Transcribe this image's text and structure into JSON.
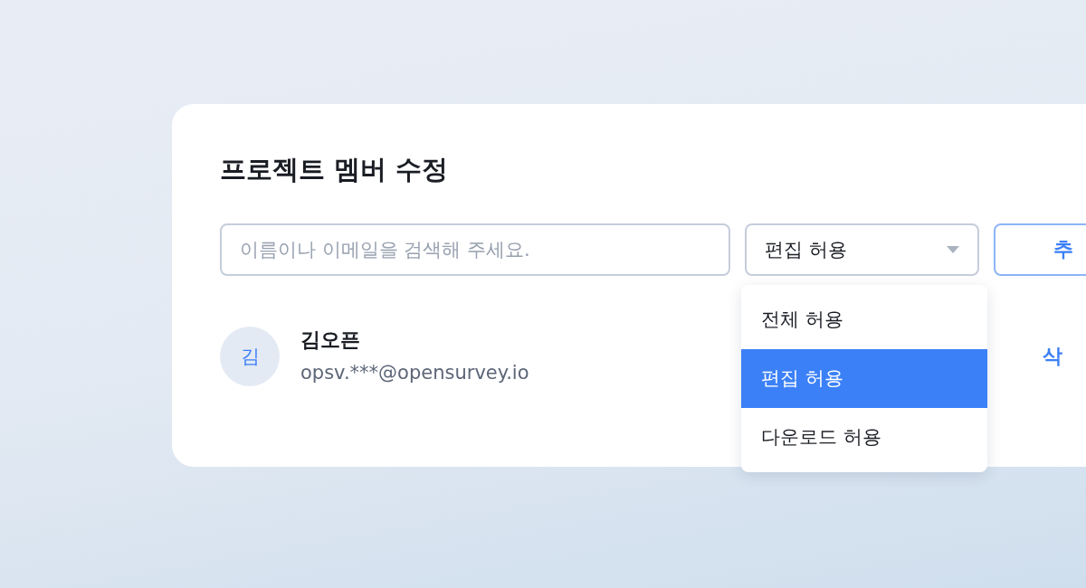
{
  "dialog": {
    "title": "프로젝트 멤버 수정",
    "search": {
      "placeholder": "이름이나 이메일을 검색해 주세요."
    },
    "permission_select": {
      "value": "편집 허용",
      "expanded": true,
      "options": [
        {
          "label": "전체 허용",
          "selected": false
        },
        {
          "label": "편집 허용",
          "selected": true
        },
        {
          "label": "다운로드 허용",
          "selected": false
        }
      ]
    },
    "add_button": "추",
    "members": [
      {
        "initial": "김",
        "name": "김오픈",
        "email": "opsv.***@opensurvey.io",
        "delete_button": "삭"
      }
    ]
  }
}
